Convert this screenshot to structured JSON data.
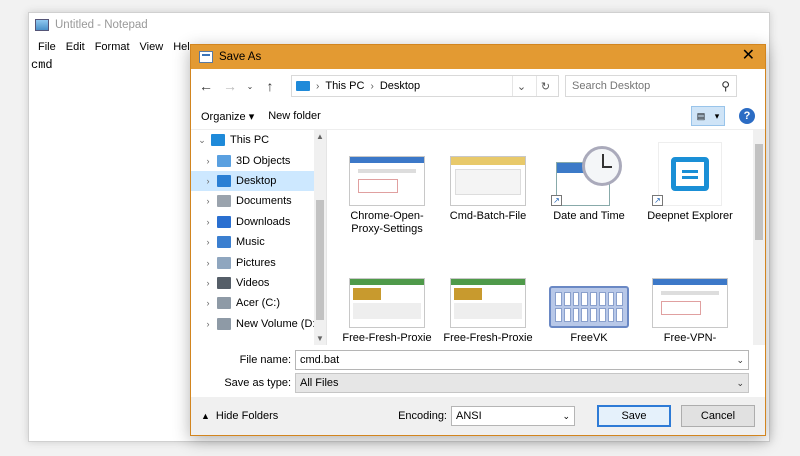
{
  "notepad": {
    "title": "Untitled - Notepad",
    "menu": [
      "File",
      "Edit",
      "Format",
      "View",
      "Help"
    ],
    "content": "cmd"
  },
  "dialog": {
    "title": "Save As",
    "close": "✕",
    "breadcrumb": [
      "This PC",
      "Desktop"
    ],
    "search_placeholder": "Search Desktop",
    "organize": "Organize ▾",
    "new_folder": "New folder",
    "help": "?",
    "nav": [
      {
        "label": "This PC",
        "icon": "pc-icon",
        "color": "#1f8ad9",
        "expander": "⌄",
        "indent": 0
      },
      {
        "label": "3D Objects",
        "icon": "cube-icon",
        "color": "#5aa0e0",
        "expander": "›",
        "indent": 1
      },
      {
        "label": "Desktop",
        "icon": "desktop-icon",
        "color": "#2a7fd4",
        "expander": "›",
        "indent": 1,
        "selected": true
      },
      {
        "label": "Documents",
        "icon": "document-icon",
        "color": "#9aa3ad",
        "expander": "›",
        "indent": 1
      },
      {
        "label": "Downloads",
        "icon": "download-icon",
        "color": "#2a6fd0",
        "expander": "›",
        "indent": 1
      },
      {
        "label": "Music",
        "icon": "music-icon",
        "color": "#3b7fd0",
        "expander": "›",
        "indent": 1
      },
      {
        "label": "Pictures",
        "icon": "picture-icon",
        "color": "#8fa6bf",
        "expander": "›",
        "indent": 1
      },
      {
        "label": "Videos",
        "icon": "video-icon",
        "color": "#555e68",
        "expander": "›",
        "indent": 1
      },
      {
        "label": "Acer (C:)",
        "icon": "drive-icon",
        "color": "#8e9aa6",
        "expander": "›",
        "indent": 1
      },
      {
        "label": "New Volume (D:",
        "icon": "drive-icon",
        "color": "#8e9aa6",
        "expander": "›",
        "indent": 1
      }
    ],
    "files": [
      {
        "label": "Chrome-Open-Proxy-Settings",
        "kind": "screenshot"
      },
      {
        "label": "Cmd-Batch-File",
        "kind": "folder"
      },
      {
        "label": "Date and Time",
        "kind": "clock",
        "shortcut": true
      },
      {
        "label": "Deepnet Explorer",
        "kind": "app",
        "shortcut": true
      },
      {
        "label": "Free-Fresh-Proxie",
        "kind": "screenshot-green"
      },
      {
        "label": "Free-Fresh-Proxie",
        "kind": "screenshot-green"
      },
      {
        "label": "FreeVK",
        "kind": "keyboard"
      },
      {
        "label": "Free-VPN-Chrome-Extension",
        "kind": "screenshot"
      }
    ],
    "file_name_label": "File name:",
    "file_name": "cmd.bat",
    "save_type_label": "Save as type:",
    "save_type": "All Files",
    "hide_folders": "Hide Folders",
    "encoding_label": "Encoding:",
    "encoding": "ANSI",
    "save": "Save",
    "cancel": "Cancel"
  }
}
